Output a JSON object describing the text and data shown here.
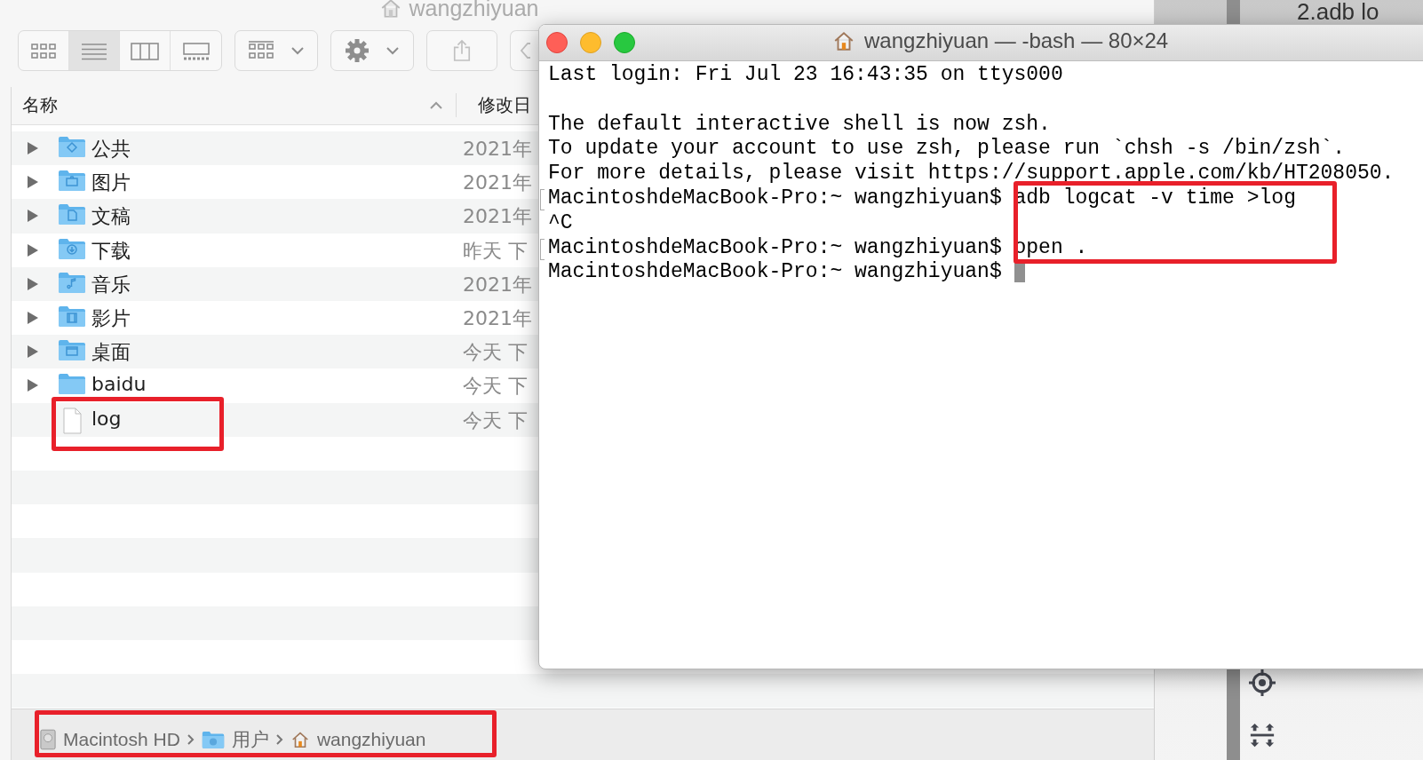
{
  "background_window": {
    "title": "2.adb lo"
  },
  "finder": {
    "title": "wangzhiyuan",
    "views": [
      {
        "kind": "icons",
        "selected": false
      },
      {
        "kind": "list",
        "selected": true
      },
      {
        "kind": "columns",
        "selected": false
      },
      {
        "kind": "gallery",
        "selected": false
      }
    ],
    "columns": [
      "名称",
      "修改日"
    ],
    "rows": [
      {
        "name": "公共",
        "kind": "public",
        "expandable": true,
        "date": "2021年"
      },
      {
        "name": "图片",
        "kind": "pictures",
        "expandable": true,
        "date": "2021年"
      },
      {
        "name": "文稿",
        "kind": "documents",
        "expandable": true,
        "date": "2021年"
      },
      {
        "name": "下载",
        "kind": "downloads",
        "expandable": true,
        "date": "昨天 下"
      },
      {
        "name": "音乐",
        "kind": "music",
        "expandable": true,
        "date": "2021年"
      },
      {
        "name": "影片",
        "kind": "movies",
        "expandable": true,
        "date": "2021年"
      },
      {
        "name": "桌面",
        "kind": "desktop",
        "expandable": true,
        "date": "今天 下"
      },
      {
        "name": "baidu",
        "kind": "folder",
        "expandable": true,
        "date": "今天 下"
      },
      {
        "name": "log",
        "kind": "file",
        "expandable": false,
        "date": "今天 下"
      }
    ],
    "path": [
      {
        "label": "Macintosh HD",
        "kind": "disk"
      },
      {
        "label": "用户",
        "kind": "users"
      },
      {
        "label": "wangzhiyuan",
        "kind": "home"
      }
    ]
  },
  "annotations": [
    {
      "kind": "terminal_commands"
    },
    {
      "kind": "finder_file"
    },
    {
      "kind": "path_bar"
    }
  ],
  "terminal": {
    "title": "wangzhiyuan — -bash — 80×24",
    "lines": [
      {
        "kind": "output",
        "text": "Last login: Fri Jul 23 16:43:35 on ttys000",
        "marked": false,
        "cursor": false
      },
      {
        "kind": "blank"
      },
      {
        "kind": "output",
        "text": "The default interactive shell is now zsh.",
        "marked": false,
        "cursor": false
      },
      {
        "kind": "output",
        "text": "To update your account to use zsh, please run `chsh -s /bin/zsh`.",
        "marked": false,
        "cursor": false
      },
      {
        "kind": "output",
        "text": "For more details, please visit https://support.apple.com/kb/HT208050.",
        "marked": false,
        "cursor": false
      },
      {
        "kind": "prompt",
        "text": "MacintoshdeMacBook-Pro:~ wangzhiyuan$ adb logcat -v time >log",
        "marked": true,
        "cursor": false
      },
      {
        "kind": "output",
        "text": "^C",
        "marked": false,
        "cursor": false
      },
      {
        "kind": "prompt",
        "text": "MacintoshdeMacBook-Pro:~ wangzhiyuan$ open .",
        "marked": true,
        "cursor": false
      },
      {
        "kind": "prompt",
        "text": "MacintoshdeMacBook-Pro:~ wangzhiyuan$",
        "marked": false,
        "cursor": true
      }
    ]
  }
}
